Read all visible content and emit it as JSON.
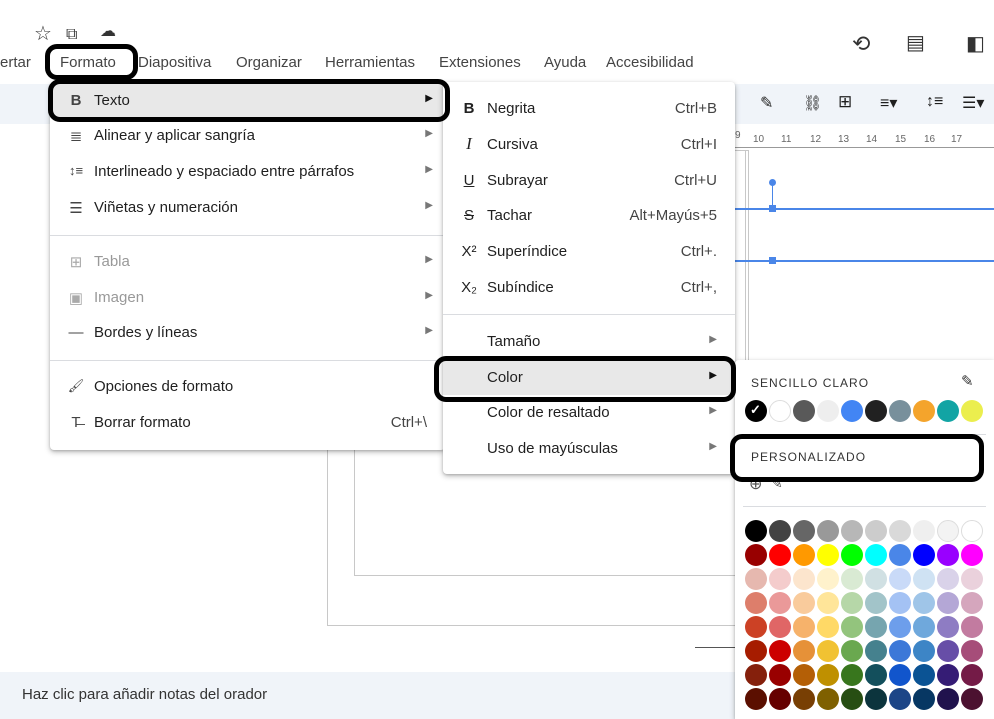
{
  "menubar": [
    "ertar",
    "Formato",
    "Diapositiva",
    "Organizar",
    "Herramientas",
    "Extensiones",
    "Ayuda",
    "Accesibilidad"
  ],
  "formato_menu": [
    {
      "icon": "B",
      "label": "Texto",
      "shortcut": "",
      "arrow": true,
      "disabled": false
    },
    {
      "icon": "≣",
      "label": "Alinear y aplicar sangría",
      "shortcut": "",
      "arrow": true,
      "disabled": false
    },
    {
      "icon": "↕≡",
      "label": "Interlineado y espaciado entre párrafos",
      "shortcut": "",
      "arrow": true,
      "disabled": false
    },
    {
      "icon": "☰",
      "label": "Viñetas y numeración",
      "shortcut": "",
      "arrow": true,
      "disabled": false
    },
    {
      "icon": "⊞",
      "label": "Tabla",
      "shortcut": "",
      "arrow": true,
      "disabled": true
    },
    {
      "icon": "▣",
      "label": "Imagen",
      "shortcut": "",
      "arrow": true,
      "disabled": true
    },
    {
      "icon": "—",
      "label": "Bordes y líneas",
      "shortcut": "",
      "arrow": true,
      "disabled": false
    },
    {
      "icon": "🖌",
      "label": "Opciones de formato",
      "shortcut": "",
      "arrow": false,
      "disabled": false
    },
    {
      "icon": "T̶",
      "label": "Borrar formato",
      "shortcut": "Ctrl+\\",
      "arrow": false,
      "disabled": false
    }
  ],
  "texto_menu": [
    {
      "icon": "B",
      "label": "Negrita",
      "shortcut": "Ctrl+B",
      "arrow": false
    },
    {
      "icon": "I",
      "label": "Cursiva",
      "shortcut": "Ctrl+I",
      "arrow": false
    },
    {
      "icon": "U",
      "label": "Subrayar",
      "shortcut": "Ctrl+U",
      "arrow": false
    },
    {
      "icon": "S",
      "label": "Tachar",
      "shortcut": "Alt+Mayús+5",
      "arrow": false
    },
    {
      "icon": "X²",
      "label": "Superíndice",
      "shortcut": "Ctrl+.",
      "arrow": false
    },
    {
      "icon": "X₂",
      "label": "Subíndice",
      "shortcut": "Ctrl+,",
      "arrow": false
    },
    {
      "icon": "",
      "label": "Tamaño",
      "shortcut": "",
      "arrow": true
    },
    {
      "icon": "",
      "label": "Color",
      "shortcut": "",
      "arrow": true
    },
    {
      "icon": "",
      "label": "Color de resaltado",
      "shortcut": "",
      "arrow": true
    },
    {
      "icon": "",
      "label": "Uso de mayúsculas",
      "shortcut": "",
      "arrow": true
    }
  ],
  "color_panel": {
    "simple_label": "SENCILLO CLARO",
    "custom_label": "PERSONALIZADO",
    "simple_colors": [
      "#000000",
      "#ffffff",
      "#595959",
      "#eeeeee",
      "#4285f4",
      "#212121",
      "#78909c",
      "#f4a42c",
      "#12a4a4",
      "#ebee4e"
    ],
    "grid": [
      [
        "#000000",
        "#434343",
        "#666666",
        "#999999",
        "#b7b7b7",
        "#cccccc",
        "#d9d9d9",
        "#efefef",
        "#f3f3f3",
        "#ffffff"
      ],
      [
        "#980000",
        "#ff0000",
        "#ff9900",
        "#ffff00",
        "#00ff00",
        "#00ffff",
        "#4a86e8",
        "#0000ff",
        "#9900ff",
        "#ff00ff"
      ],
      [
        "#e6b8af",
        "#f4cccc",
        "#fce5cd",
        "#fff2cc",
        "#d9ead3",
        "#d0e0e3",
        "#c9daf8",
        "#cfe2f3",
        "#d9d2e9",
        "#ead1dc"
      ],
      [
        "#dd7e6b",
        "#ea9999",
        "#f9cb9c",
        "#ffe599",
        "#b6d7a8",
        "#a2c4c9",
        "#a4c2f4",
        "#9fc5e8",
        "#b4a7d6",
        "#d5a6bd"
      ],
      [
        "#cc4125",
        "#e06666",
        "#f6b26b",
        "#ffd966",
        "#93c47d",
        "#76a5af",
        "#6d9eeb",
        "#6fa8dc",
        "#8e7cc3",
        "#c27ba0"
      ],
      [
        "#a61c00",
        "#cc0000",
        "#e69138",
        "#f1c232",
        "#6aa84f",
        "#45818e",
        "#3c78d8",
        "#3d85c6",
        "#674ea7",
        "#a64d79"
      ],
      [
        "#85200c",
        "#990000",
        "#b45f06",
        "#bf9000",
        "#38761d",
        "#134f5c",
        "#1155cc",
        "#0b5394",
        "#351c75",
        "#741b47"
      ],
      [
        "#5b0f00",
        "#660000",
        "#783f04",
        "#7f6000",
        "#274e13",
        "#0c343d",
        "#1c4587",
        "#073763",
        "#20124d",
        "#4c1130"
      ]
    ]
  },
  "ruler_ticks": [
    "9",
    "10",
    "11",
    "12",
    "13",
    "14",
    "15",
    "16",
    "17"
  ],
  "notes_placeholder": "Haz clic para añadir notas del orador"
}
